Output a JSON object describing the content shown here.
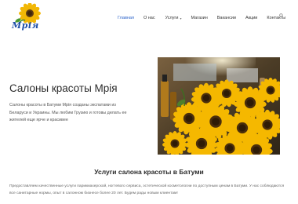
{
  "logo": {
    "text": "Мрія",
    "icon": "sunflower-icon"
  },
  "nav": {
    "items": [
      {
        "label": "Главная",
        "active": true
      },
      {
        "label": "О нас"
      },
      {
        "label": "Услуги",
        "has_dropdown": true
      },
      {
        "label": "Магазин"
      },
      {
        "label": "Вакансии"
      },
      {
        "label": "Акции"
      },
      {
        "label": "Контакты"
      }
    ],
    "search_icon": "search-icon"
  },
  "hero": {
    "title": "Салоны красоты Мрія",
    "text": "Салоны красоты в Батуми Мрія созданы экспатами из Беларуси и Украины. Мы любим Грузию и готовы делать ее жителей еще ярче и красивее",
    "image": "sunflowers-photo"
  },
  "services": {
    "title": "Услуги салона красоты в Батуми",
    "text": "Предоставляем качественные услуги парикмахерской, ногтевого сервиса, эстетической косметологии по доступным ценам в Батуми. У нас соблюдаются все санитарные нормы, опыт в салонном бизнесе более 20 лет. Будем рады новым клиентам!"
  },
  "colors": {
    "accent": "#2a62c9",
    "text": "#333333",
    "background": "#ffffff"
  }
}
